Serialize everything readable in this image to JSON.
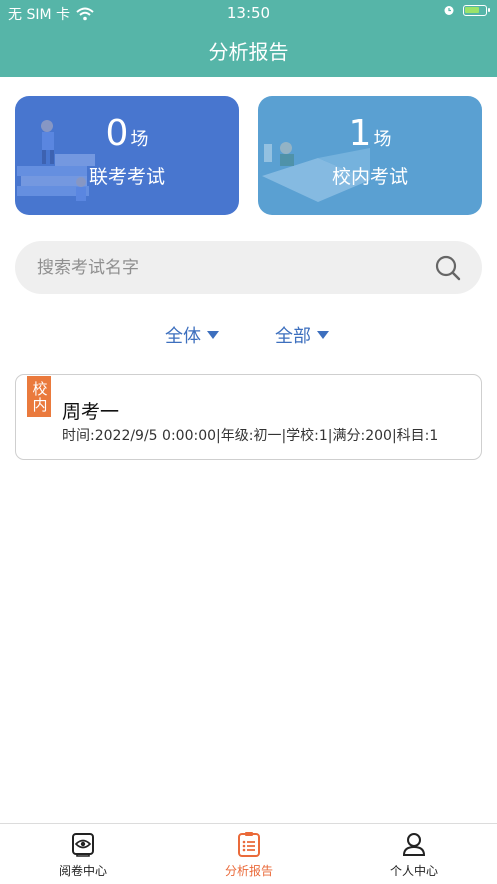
{
  "status_bar": {
    "carrier": "无 SIM 卡",
    "time": "13:50"
  },
  "header": {
    "title": "分析报告"
  },
  "cards": [
    {
      "count": "0",
      "unit": "场",
      "label": "联考考试",
      "color": "#4876cf"
    },
    {
      "count": "1",
      "unit": "场",
      "label": "校内考试",
      "color": "#5aa0d2"
    }
  ],
  "search": {
    "placeholder": "搜索考试名字",
    "value": ""
  },
  "filters": {
    "scope": "全体",
    "type": "全部"
  },
  "exams": [
    {
      "tag": "校内",
      "title": "周考一",
      "meta": "时间:2022/9/5 0:00:00|年级:初一|学校:1|满分:200|科目:1"
    }
  ],
  "tabbar": {
    "items": [
      {
        "label": "阅卷中心",
        "icon": "eye-doc-icon",
        "active": false
      },
      {
        "label": "分析报告",
        "icon": "clipboard-list-icon",
        "active": true
      },
      {
        "label": "个人中心",
        "icon": "person-icon",
        "active": false
      }
    ],
    "active_color": "#ea6a3a"
  },
  "colors": {
    "header": "#56b5a8",
    "accent_text": "#3d6fbe",
    "tag": "#ea7a3d"
  }
}
